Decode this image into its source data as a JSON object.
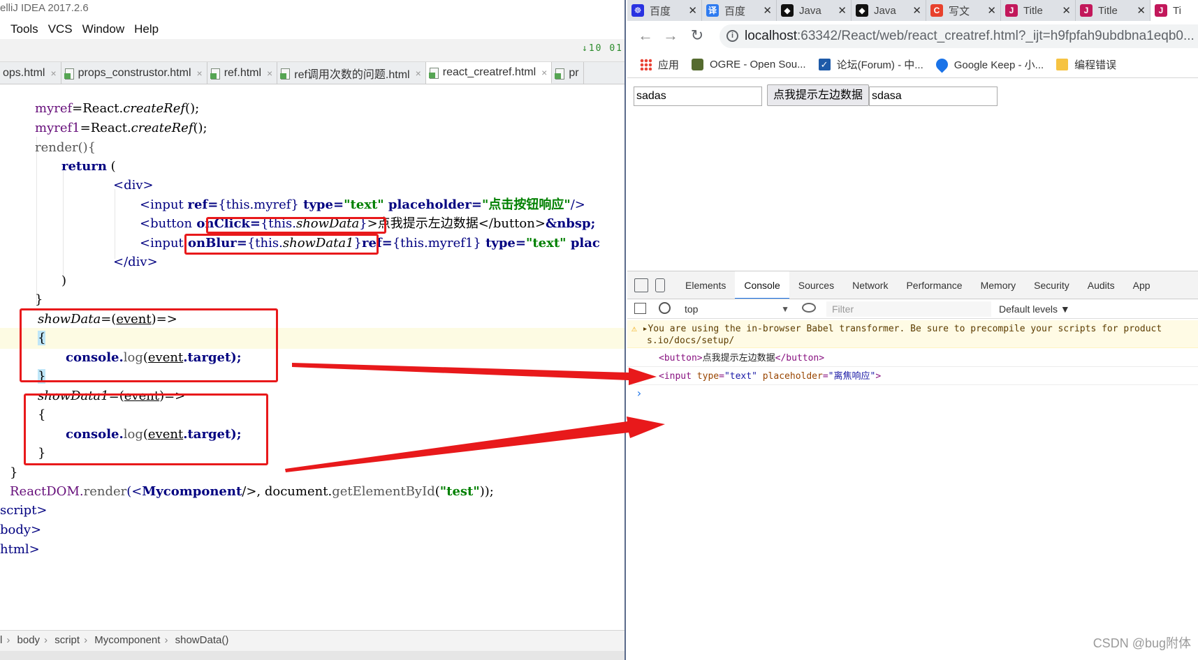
{
  "ide": {
    "title": "elliJ IDEA 2017.2.6",
    "menu": [
      "Tools",
      "VCS",
      "Window",
      "Help"
    ],
    "toolbar_icons": "↓10 01",
    "tabs": [
      {
        "label": "ops.html",
        "active": false
      },
      {
        "label": "props_construstor.html",
        "active": false
      },
      {
        "label": "ref.html",
        "active": false
      },
      {
        "label": "ref调用次数的问题.html",
        "active": false
      },
      {
        "label": "react_creatref.html",
        "active": true
      },
      {
        "label": "pr",
        "active": false
      }
    ],
    "code": {
      "l1": {
        "var": "myref",
        "eq": "=React.",
        "fn": "createRef",
        "tail": "();"
      },
      "l2": {
        "var": "myref1",
        "eq": "=React.",
        "fn": "createRef",
        "tail": "();"
      },
      "l3": {
        "text": "render(){"
      },
      "l4": {
        "kw": "return",
        "tail": " ("
      },
      "l5": {
        "tag": "<div>"
      },
      "l6": {
        "a": "<input ",
        "b": "ref=",
        "c": "{this.myref}",
        "d": " type=",
        "e": "\"text\"",
        "f": " placeholder=",
        "g": "\"点击按钮响应\"",
        "h": "/>"
      },
      "l7": {
        "a": "<button",
        "b": " onClick=",
        "c": "{this.",
        "d": "showData",
        "e": "}",
        "f": ">点我提示左边数据</button>",
        "g": "&nbsp;"
      },
      "l8": {
        "a": "<input",
        "b": " onBlur=",
        "c": "{this.",
        "d": "showData1",
        "e": "}",
        "f": "ref=",
        "g": "{this.myref1}",
        "h": " type=",
        "i": "\"text\"",
        "j": " plac"
      },
      "l9": {
        "tag": "</div>"
      },
      "l10": {
        "text": ")"
      },
      "l11": {
        "text": "}"
      },
      "l12": {
        "fn": "showData",
        "mid": "=(",
        "arg": "event",
        "tail": ")=>"
      },
      "l13": {
        "text": "{"
      },
      "l14": {
        "a": "console.",
        "b": "log",
        "c": "(",
        "d": "event",
        "e": ".target);"
      },
      "l15": {
        "text": "}"
      },
      "l16": {
        "fn": "showData1",
        "mid": "=(",
        "arg": "event",
        "tail": ")=>"
      },
      "l17": {
        "text": "{"
      },
      "l18": {
        "a": "console.",
        "b": "log",
        "c": "(",
        "d": "event",
        "e": ".target);"
      },
      "l19": {
        "text": "}"
      },
      "l20": {
        "text": "}"
      },
      "l21": {
        "a": "ReactDOM.",
        "b": "render",
        "c": "(<",
        "d": "Mycomponent",
        "e": "/>, document.",
        "f": "getElementById",
        "g": "(",
        "h": "\"test\"",
        "i": "));"
      },
      "l22": {
        "text": "script>"
      },
      "l23": {
        "text": "body>"
      },
      "l24": {
        "text": "html>"
      }
    },
    "breadcrumb": [
      "l",
      "body",
      "script",
      "Mycomponent",
      "showData()"
    ]
  },
  "browser": {
    "tabs": [
      {
        "label": "百度",
        "icon_color": "#2932e1",
        "icon": "paw-icon",
        "glyph": "☸"
      },
      {
        "label": "百度",
        "icon_color": "#2f7bf0",
        "icon": "translate-icon",
        "glyph": "译"
      },
      {
        "label": "Java",
        "icon_color": "#111111",
        "icon": "github-icon",
        "glyph": "◆"
      },
      {
        "label": "Java",
        "icon_color": "#111111",
        "icon": "github-icon",
        "glyph": "◆"
      },
      {
        "label": "写文",
        "icon_color": "#e8412c",
        "icon": "csdn-icon",
        "glyph": "C"
      },
      {
        "label": "Title",
        "icon_color": "#c2185b",
        "icon": "intellij-icon",
        "glyph": "J"
      },
      {
        "label": "Title",
        "icon_color": "#c2185b",
        "icon": "intellij-icon",
        "glyph": "J"
      },
      {
        "label": "Ti",
        "icon_color": "#c2185b",
        "icon": "intellij-icon",
        "glyph": "J"
      }
    ],
    "url_host": "localhost",
    "url_rest": ":63342/React/web/react_creatref.html?_ijt=h9fpfah9ubdbna1eqb0...",
    "bookmarks": [
      {
        "label": "应用",
        "icon": "apps-grid-icon"
      },
      {
        "label": "OGRE - Open Sou...",
        "icon": "ogre-icon"
      },
      {
        "label": "论坛(Forum) - 中...",
        "icon": "checkmark-icon"
      },
      {
        "label": "Google Keep - 小...",
        "icon": "keep-icon"
      },
      {
        "label": "编程错误",
        "icon": "folder-icon"
      }
    ],
    "page": {
      "input1_value": "sadas",
      "button_label": "点我提示左边数据",
      "input2_value": "sdasa"
    },
    "devtools": {
      "tabs": [
        "Elements",
        "Console",
        "Sources",
        "Network",
        "Performance",
        "Memory",
        "Security",
        "Audits",
        "App"
      ],
      "active_tab": "Console",
      "context": "top",
      "filter_placeholder": "Filter",
      "levels": "Default levels ▼",
      "warning_line1": "▸You are using the in-browser Babel transformer. Be sure to precompile your scripts for product",
      "warning_line2": "s.io/docs/setup/",
      "log1": {
        "open": "<button>",
        "text": "点我提示左边数据",
        "close": "</button>"
      },
      "log2": {
        "open": "<input ",
        "attr1": "type",
        "val1": "\"text\"",
        "attr2": "placeholder",
        "val2": "\"离焦响应\"",
        "close": ">"
      },
      "prompt": "›"
    }
  },
  "watermark": "CSDN @bug附体",
  "colors": {
    "annotation_red": "#e8191b",
    "keyword": "#000080",
    "string": "#008000"
  }
}
